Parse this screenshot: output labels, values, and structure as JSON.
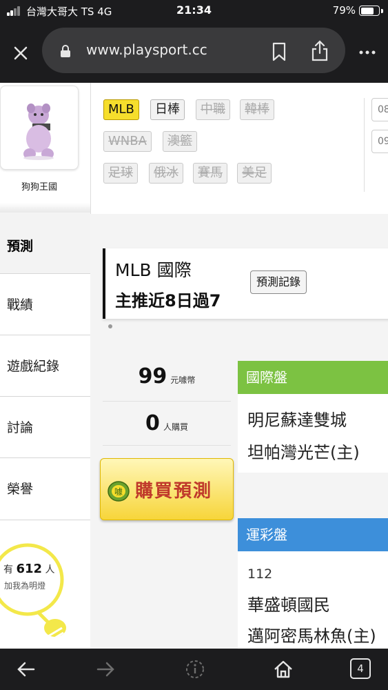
{
  "status_bar": {
    "carrier": "台灣大哥大 TS   4G",
    "time": "21:34",
    "battery_pct": "79%",
    "battery_level": 0.79
  },
  "browser": {
    "url": "www.playsport.cc",
    "tabs_count": "4"
  },
  "user": {
    "name": "狗狗王國"
  },
  "sidebar": {
    "active_item": "預測",
    "items": [
      {
        "label": "戰績"
      },
      {
        "label": "遊戲紀錄"
      },
      {
        "label": "討論"
      },
      {
        "label": "榮譽"
      }
    ],
    "fans": {
      "prefix": "有",
      "count": "612",
      "suffix": "人",
      "caption": "加我為明燈"
    }
  },
  "sports": [
    {
      "label": "MLB",
      "state": "active"
    },
    {
      "label": "日棒",
      "state": "enabled"
    },
    {
      "label": "中職",
      "state": "disabled"
    },
    {
      "label": "韓棒",
      "state": "disabled"
    },
    {
      "label": "WNBA",
      "state": "disabled"
    },
    {
      "label": "澳籃",
      "state": "disabled"
    },
    {
      "label": "足球",
      "state": "disabled"
    },
    {
      "label": "俄冰",
      "state": "disabled"
    },
    {
      "label": "賽馬",
      "state": "disabled"
    },
    {
      "label": "美足",
      "state": "disabled"
    }
  ],
  "dates": [
    "08",
    "09"
  ],
  "prediction": {
    "title": "MLB 國際",
    "subtitle": "主推近8日過7",
    "record_button": "預測記錄",
    "price": "99",
    "price_unit": "元噱幣",
    "buyers": "0",
    "buyers_unit": "人購買",
    "buy_button": "購買預測",
    "coin_label": "噱"
  },
  "picks": [
    {
      "header": "國際盤",
      "color": "#7cc242",
      "game_no": "",
      "teams": [
        "明尼蘇達雙城",
        "坦帕灣光芒(主)"
      ]
    },
    {
      "header": "運彩盤",
      "color": "#3d8fda",
      "game_no": "112",
      "teams": [
        "華盛頓國民",
        "邁阿密馬林魚(主)"
      ]
    }
  ]
}
